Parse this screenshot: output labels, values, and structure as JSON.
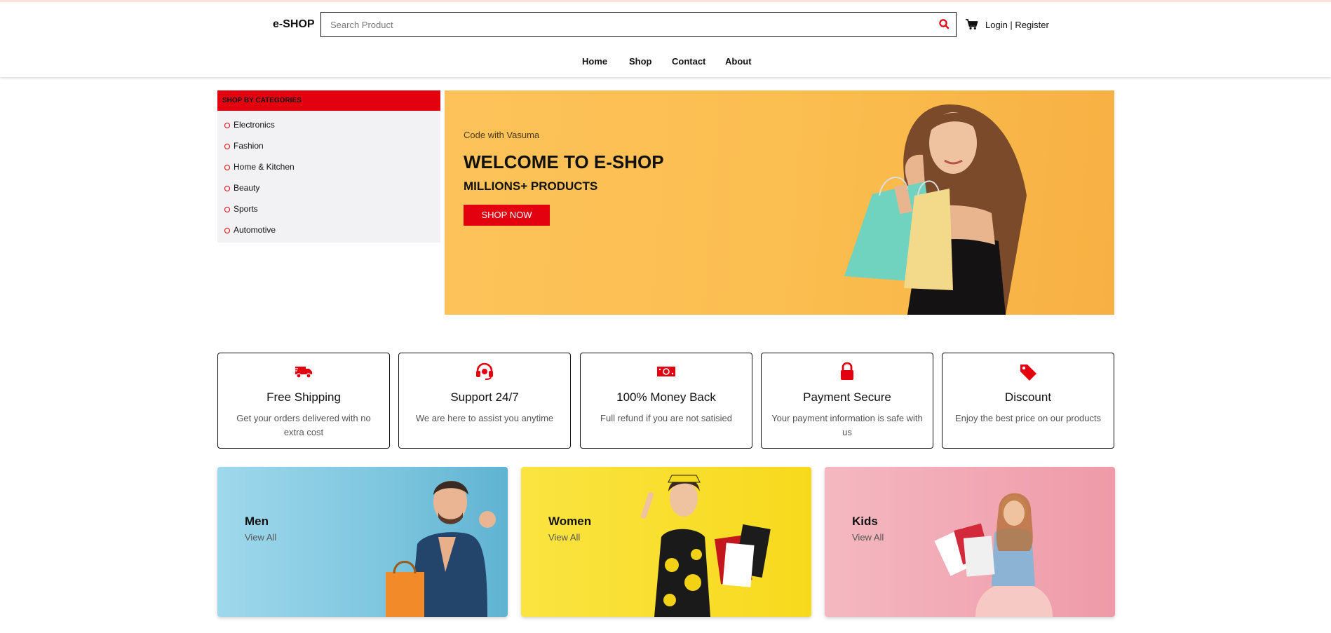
{
  "header": {
    "logo": "e-SHOP",
    "search_placeholder": "Search Product",
    "login": "Login",
    "separator": " | ",
    "register": "Register"
  },
  "nav": {
    "items": [
      "Home",
      "Shop",
      "Contact",
      "About"
    ]
  },
  "categories": {
    "heading": "SHOP BY CATEGORIES",
    "items": [
      "Electronics",
      "Fashion",
      "Home & Kitchen",
      "Beauty",
      "Sports",
      "Automotive"
    ]
  },
  "hero": {
    "tagline": "Code with Vasuma",
    "title": "WELCOME TO E-SHOP",
    "subtitle": "MILLIONS+ PRODUCTS",
    "button": "SHOP NOW"
  },
  "features": [
    {
      "icon": "truck-icon",
      "title": "Free Shipping",
      "text": "Get your orders delivered with no extra cost"
    },
    {
      "icon": "headset-icon",
      "title": "Support 24/7",
      "text": "We are here to assist you anytime"
    },
    {
      "icon": "money-icon",
      "title": "100% Money Back",
      "text": "Full refund if you are not satisied"
    },
    {
      "icon": "lock-icon",
      "title": "Payment Secure",
      "text": "Your payment information is safe with us"
    },
    {
      "icon": "tag-icon",
      "title": "Discount",
      "text": "Enjoy the best price on our products"
    }
  ],
  "banners": [
    {
      "title": "Men",
      "link": "View All"
    },
    {
      "title": "Women",
      "link": "View All"
    },
    {
      "title": "Kids",
      "link": "View All"
    }
  ],
  "colors": {
    "accent": "#e3000f",
    "hero_bg": "#fbbd4f",
    "men_bg": "#8fcfe4",
    "women_bg": "#fbe233",
    "kids_bg": "#f2b0ba"
  }
}
